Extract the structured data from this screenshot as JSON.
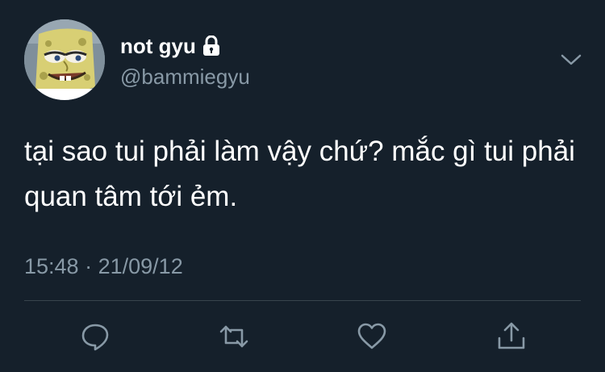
{
  "user": {
    "display_name": "not gyu",
    "handle": "@bammiegyu",
    "protected_icon": "lock-icon",
    "avatar_icon": "spongebob-avatar"
  },
  "tweet": {
    "text": "tại sao tui phải làm vậy chứ? mắc gì tui phải quan tâm tới ẻm.",
    "time": "15:48",
    "separator": "·",
    "date": "21/09/12"
  },
  "actions": [
    {
      "name": "reply",
      "icon": "reply-bubble-icon"
    },
    {
      "name": "retweet",
      "icon": "retweet-icon"
    },
    {
      "name": "like",
      "icon": "heart-icon"
    },
    {
      "name": "share",
      "icon": "share-icon"
    }
  ],
  "colors": {
    "background": "#15202b",
    "primary_text": "#ffffff",
    "secondary_text": "#8899a6",
    "divider": "#38444d"
  }
}
